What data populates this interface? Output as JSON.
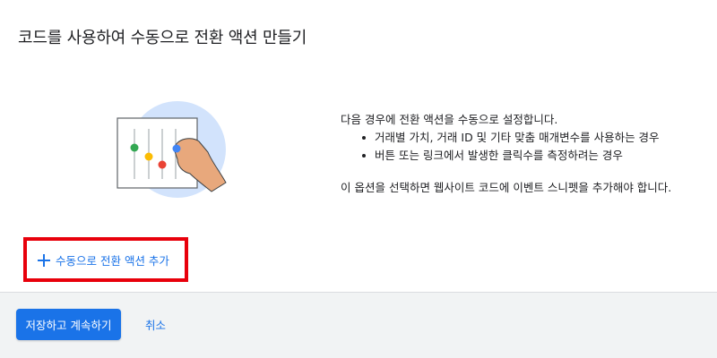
{
  "dialog": {
    "title": "코드를 사용하여 수동으로 전환 액션 만들기"
  },
  "info": {
    "intro": "다음 경우에 전환 액션을 수동으로 설정합니다.",
    "bullets": [
      "거래별 가치, 거래 ID 및 기타 맞춤 매개변수를 사용하는 경우",
      "버튼 또는 링크에서 발생한 클릭수를 측정하려는 경우"
    ],
    "note": "이 옵션을 선택하면 웹사이트 코드에 이벤트 스니펫을 추가해야 합니다."
  },
  "actions": {
    "add_label": "수동으로 전환 액션 추가"
  },
  "footer": {
    "save_label": "저장하고 계속하기",
    "cancel_label": "취소"
  },
  "colors": {
    "accent": "#1a73e8",
    "highlight": "#e8000b",
    "footer_bg": "#f1f3f4",
    "illustration_circle": "#d2e3fc",
    "dot_green": "#34a853",
    "dot_yellow": "#fbbc04",
    "dot_red": "#ea4335",
    "dot_blue": "#4285f4",
    "hand": "#e8a87c"
  }
}
